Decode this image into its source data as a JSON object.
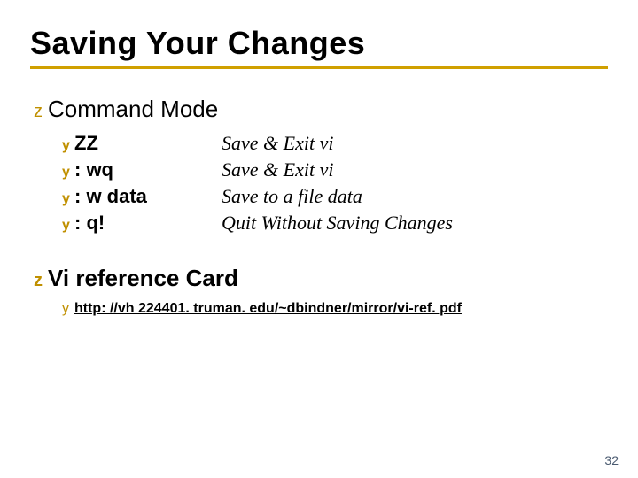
{
  "title": "Saving Your Changes",
  "section1": {
    "heading": "Command Mode",
    "rows": [
      {
        "cmd": "ZZ",
        "desc": "Save & Exit vi"
      },
      {
        "cmd": ": wq",
        "desc": "Save & Exit vi"
      },
      {
        "cmd": ": w data",
        "desc": "Save to a file data"
      },
      {
        "cmd": ": q!",
        "desc": "Quit Without Saving Changes"
      }
    ]
  },
  "section2": {
    "heading": "Vi reference Card",
    "link": "http: //vh 224401. truman. edu/~dbindner/mirror/vi-ref. pdf"
  },
  "bullets": {
    "z": "z",
    "y": "y"
  },
  "page_number": "32"
}
